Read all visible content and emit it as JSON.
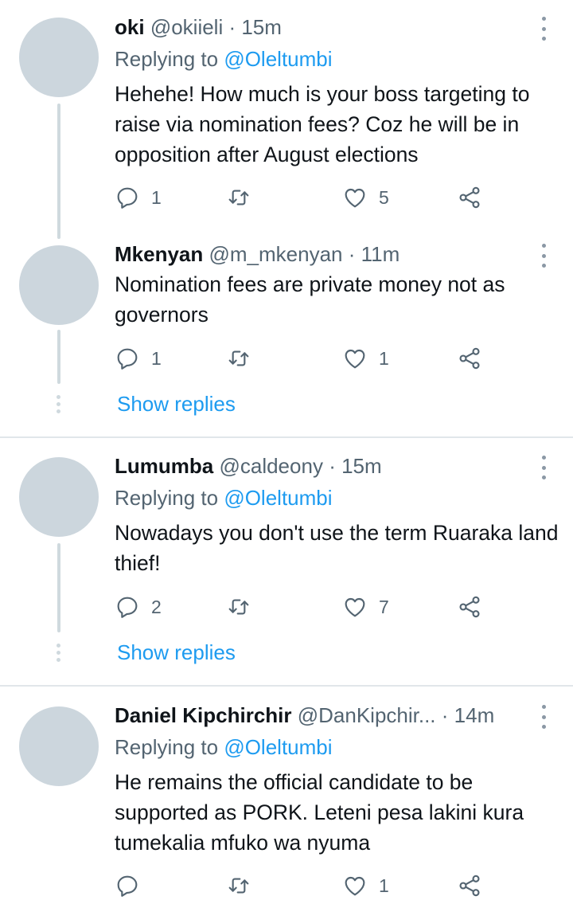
{
  "tweets": [
    {
      "name": "oki",
      "handle": "@okiieli",
      "time": "· 15m",
      "replying_prefix": "Replying to ",
      "replying_to": "@Oleltumbi",
      "text": "Hehehe! How much is your boss targeting to raise via nomination fees? Coz he will be in opposition after August elections",
      "replies": "1",
      "retweets": "",
      "likes": "5"
    },
    {
      "name": "Mkenyan",
      "handle": "@m_mkenyan",
      "time": "· 11m",
      "text": "Nomination fees are private money not as governors",
      "replies": "1",
      "retweets": "",
      "likes": "1",
      "show_replies": "Show replies"
    },
    {
      "name": "Lumumba",
      "handle": "@caldeony",
      "time": "· 15m",
      "replying_prefix": "Replying to ",
      "replying_to": "@Oleltumbi",
      "text": "Nowadays you don't use the term Ruaraka land thief!",
      "replies": "2",
      "retweets": "",
      "likes": "7",
      "show_replies": "Show replies"
    },
    {
      "name": "Daniel Kipchirchir",
      "handle": "@DanKipchir...",
      "time": "· 14m",
      "replying_prefix": "Replying to ",
      "replying_to": "@Oleltumbi",
      "text": "He remains the official candidate to be supported as PORK. Leteni pesa lakini kura tumekalia mfuko wa nyuma",
      "replies": "",
      "retweets": "",
      "likes": "1"
    }
  ],
  "icons": {
    "reply": "reply-icon",
    "retweet": "retweet-icon",
    "like": "heart-icon",
    "share": "share-icon",
    "more": "more-vertical-icon"
  },
  "colors": {
    "accent": "#1d9bf0",
    "secondary_text": "#536471",
    "avatar": "#ccd6dd"
  }
}
